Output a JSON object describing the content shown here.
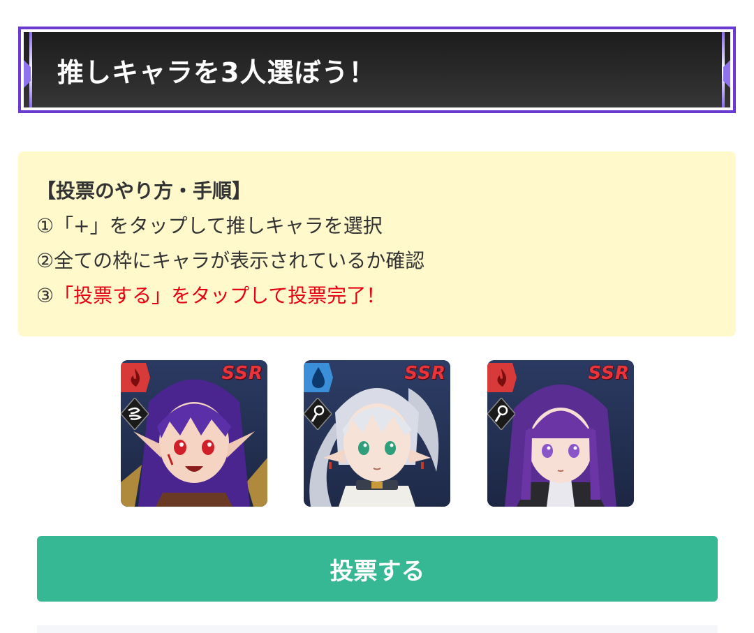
{
  "banner": {
    "title": "推しキャラを3人選ぼう！"
  },
  "howto": {
    "heading": "【投票のやり方・手順】",
    "steps": [
      {
        "text": "①「+」をタップして推しキャラを選択"
      },
      {
        "text": "②全ての枠にキャラが表示されているか確認"
      },
      {
        "prefix": "③",
        "text": "「投票する」をタップして投票完了！"
      }
    ]
  },
  "characters": [
    {
      "rarity": "SSR",
      "element": "fire",
      "element_icon": "fire-icon",
      "class_icon": "wind-icon",
      "hair": "#5b2fa8",
      "skin": "#f5d4c4",
      "eyes": "#d11f2a"
    },
    {
      "rarity": "SSR",
      "element": "water",
      "element_icon": "water-icon",
      "class_icon": "staff-icon",
      "hair": "#d9dce6",
      "skin": "#f7e2d7",
      "eyes": "#2f9e7a"
    },
    {
      "rarity": "SSR",
      "element": "fire",
      "element_icon": "fire-icon",
      "class_icon": "staff-icon",
      "hair": "#6b35a6",
      "skin": "#f7dfd6",
      "eyes": "#8a55c9"
    }
  ],
  "vote_button": {
    "label": "投票する"
  },
  "colors": {
    "accent": "#36b894",
    "banner_border": "#6b3ad1",
    "howto_bg": "#fff9cc",
    "warning_text": "#e60012",
    "rarity": "#e8343a"
  }
}
